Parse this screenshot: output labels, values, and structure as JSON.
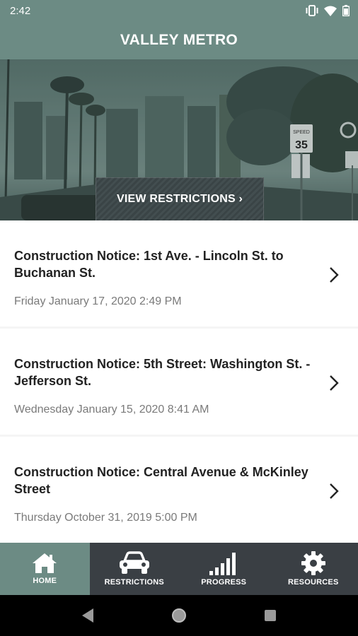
{
  "status_bar": {
    "time": "2:42"
  },
  "app": {
    "title": "VALLEY METRO"
  },
  "hero": {
    "button_label": "VIEW RESTRICTIONS ›"
  },
  "notices": [
    {
      "title": "Construction Notice: 1st Ave. - Lincoln St. to Buchanan St.",
      "date": "Friday January 17, 2020 2:49 PM"
    },
    {
      "title": "Construction Notice: 5th Street: Washington St. - Jefferson St.",
      "date": "Wednesday January 15, 2020 8:41 AM"
    },
    {
      "title": "Construction Notice: Central Avenue & McKinley Street",
      "date": "Thursday October 31, 2019 5:00 PM"
    }
  ],
  "bottom_nav": [
    {
      "label": "HOME",
      "icon": "home-icon",
      "active": true
    },
    {
      "label": "RESTRICTIONS",
      "icon": "car-icon",
      "active": false
    },
    {
      "label": "PROGRESS",
      "icon": "signal-bars-icon",
      "active": false
    },
    {
      "label": "RESOURCES",
      "icon": "gear-icon",
      "active": false
    }
  ],
  "colors": {
    "brand": "#6c8b84",
    "nav_dark": "#3a3f44"
  }
}
